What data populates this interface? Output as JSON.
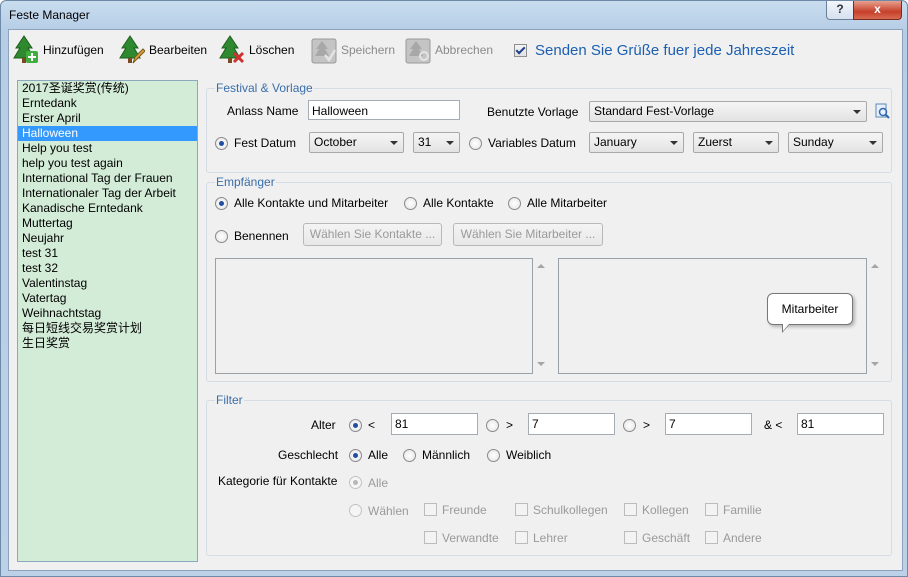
{
  "window": {
    "title": "Feste Manager",
    "help_label": "?",
    "close_label": "x"
  },
  "toolbar": {
    "add": "Hinzufügen",
    "edit": "Bearbeiten",
    "delete": "Löschen",
    "save": "Speichern",
    "cancel": "Abbrechen",
    "send_label": "Senden Sie Grüße fuer jede Jahreszeit",
    "send_checked": true
  },
  "festivals": [
    "2017圣诞奖赏(传统)",
    "Erntedank",
    "Erster April",
    "Halloween",
    "Help you test",
    "help you test again",
    "International Tag der Frauen",
    "Internationaler Tag der Arbeit",
    "Kanadische Erntedank",
    "Muttertag",
    "Neujahr",
    "test 31",
    "test 32",
    "Valentinstag",
    "Vatertag",
    "Weihnachtstag",
    "每日短线交易奖赏计划",
    "生日奖赏"
  ],
  "selected_festival": "Halloween",
  "festival_section": {
    "legend": "Festival & Vorlage",
    "occasion_label": "Anlass Name",
    "occasion_value": "Halloween",
    "template_label": "Benutzte Vorlage",
    "template_value": "Standard Fest-Vorlage",
    "fixed_date_label": "Fest Datum",
    "month": "October",
    "day": "31",
    "variable_date_label": "Variables Datum",
    "var_month": "January",
    "var_order": "Zuerst",
    "var_weekday": "Sunday"
  },
  "recipients": {
    "legend": "Empfänger",
    "opt_all_both": "Alle Kontakte und Mitarbeiter",
    "opt_all_contacts": "Alle Kontakte",
    "opt_all_staff": "Alle Mitarbeiter",
    "opt_name": "Benennen",
    "choose_contacts_btn": "Wählen Sie Kontakte ...",
    "choose_staff_btn": "Wählen Sie Mitarbeiter ...",
    "tooltip": "Mitarbeiter"
  },
  "filter": {
    "legend": "Filter",
    "age_label": "Alter",
    "lt": "<",
    "gt": ">",
    "and_lt": "& <",
    "age_1": "81",
    "age_2": "7",
    "age_3": "7",
    "age_4": "81",
    "gender_label": "Geschlecht",
    "gender_all": "Alle",
    "gender_male": "Männlich",
    "gender_female": "Weiblich",
    "category_label": "Kategorie für Kontakte",
    "cat_all": "Alle",
    "cat_choose": "Wählen",
    "cat_items": [
      "Freunde",
      "Schulkollegen",
      "Kollegen",
      "Familie",
      "Verwandte",
      "Lehrer",
      "Geschäft",
      "Andere"
    ]
  }
}
